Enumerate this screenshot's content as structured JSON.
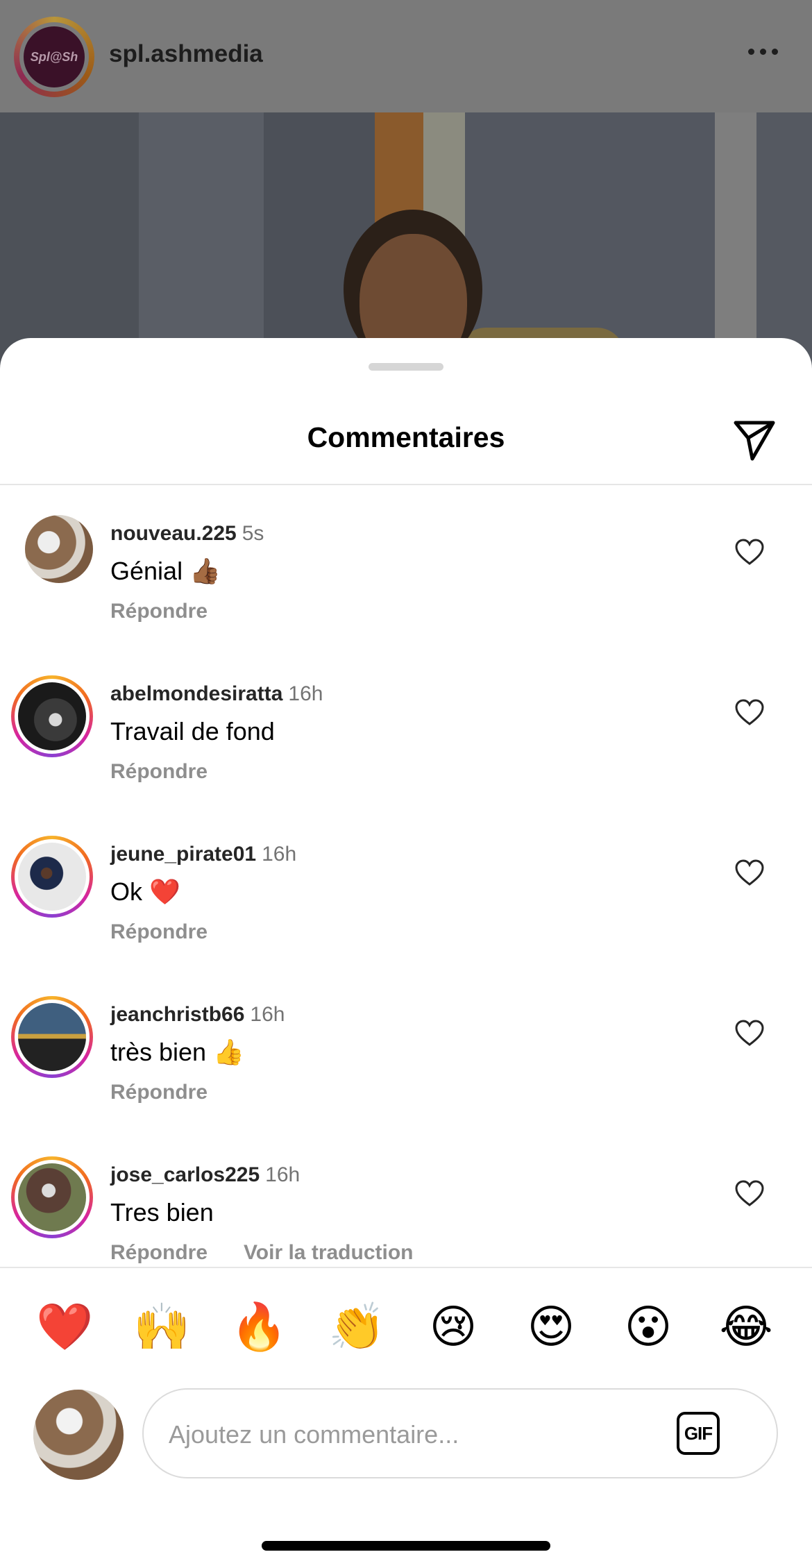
{
  "post": {
    "username": "spl.ashmedia",
    "avatar_text": "Spl@Sh"
  },
  "sheet": {
    "title": "Commentaires"
  },
  "comments": [
    {
      "username": "nouveau.225",
      "time": "5s",
      "text": "Génial 👍🏾",
      "reply": "Répondre",
      "translate": ""
    },
    {
      "username": "abelmondesiratta",
      "time": "16h",
      "text": "Travail de fond",
      "reply": "Répondre",
      "translate": ""
    },
    {
      "username": "jeune_pirate01",
      "time": "16h",
      "text": "Ok ❤️",
      "reply": "Répondre",
      "translate": ""
    },
    {
      "username": "jeanchristb66",
      "time": "16h",
      "text": "très bien 👍",
      "reply": "Répondre",
      "translate": ""
    },
    {
      "username": "jose_carlos225",
      "time": "16h",
      "text": "Tres bien",
      "reply": "Répondre",
      "translate": "Voir la traduction"
    }
  ],
  "quick_emojis": [
    "❤️",
    "🙌",
    "🔥",
    "👏",
    "😢",
    "😍",
    "😮",
    "😂"
  ],
  "composer": {
    "placeholder": "Ajoutez un commentaire...",
    "gif_label": "GIF"
  }
}
